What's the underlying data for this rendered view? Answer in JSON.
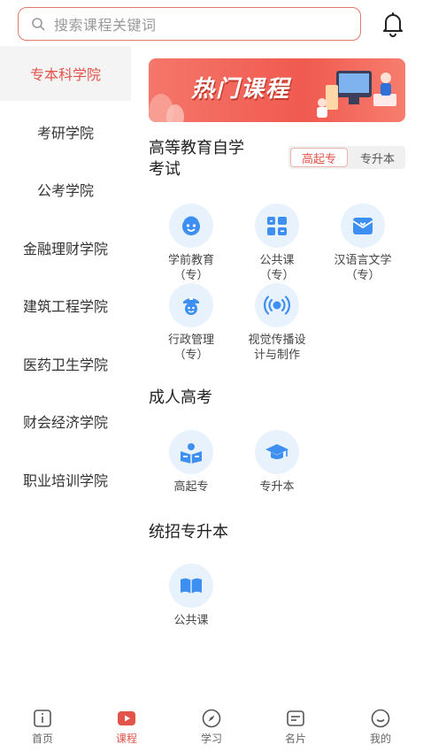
{
  "search": {
    "placeholder": "搜索课程关键词"
  },
  "sidebar": {
    "items": [
      {
        "label": "专本科学院",
        "active": true
      },
      {
        "label": "考研学院"
      },
      {
        "label": "公考学院"
      },
      {
        "label": "金融理财学院"
      },
      {
        "label": "建筑工程学院"
      },
      {
        "label": "医药卫生学院"
      },
      {
        "label": "财会经济学院"
      },
      {
        "label": "职业培训学院"
      }
    ]
  },
  "banner": {
    "title": "热门课程"
  },
  "sections": {
    "self_exam": {
      "title_line1": "高等教育自学",
      "title_line2": "考试",
      "toggle": [
        "高起专",
        "专升本"
      ],
      "items": [
        {
          "line1": "学前教育",
          "line2": "（专）",
          "icon": "child-face-icon"
        },
        {
          "line1": "公共课",
          "line2": "（专）",
          "icon": "grid-apps-icon"
        },
        {
          "line1": "汉语言文学",
          "line2": "（专）",
          "icon": "mail-heart-icon"
        },
        {
          "line1": "行政管理",
          "line2": "（专）",
          "icon": "officer-face-icon"
        },
        {
          "line1": "视觉传播设",
          "line2": "计与制作",
          "icon": "broadcast-icon"
        }
      ]
    },
    "adult": {
      "title": "成人高考",
      "items": [
        {
          "label": "高起专",
          "icon": "reading-person-icon"
        },
        {
          "label": "专升本",
          "icon": "graduation-cap-icon"
        }
      ]
    },
    "unified": {
      "title": "统招专升本",
      "items": [
        {
          "label": "公共课",
          "icon": "open-book-icon"
        }
      ]
    }
  },
  "tabs": [
    {
      "label": "首页",
      "icon": "home-icon"
    },
    {
      "label": "课程",
      "icon": "play-course-icon",
      "active": true
    },
    {
      "label": "学习",
      "icon": "compass-icon"
    },
    {
      "label": "名片",
      "icon": "card-icon"
    },
    {
      "label": "我的",
      "icon": "smile-icon"
    }
  ],
  "colors": {
    "accent": "#e2534a",
    "icon_blue": "#3d8ff2",
    "icon_bg": "#e8f2fd"
  }
}
